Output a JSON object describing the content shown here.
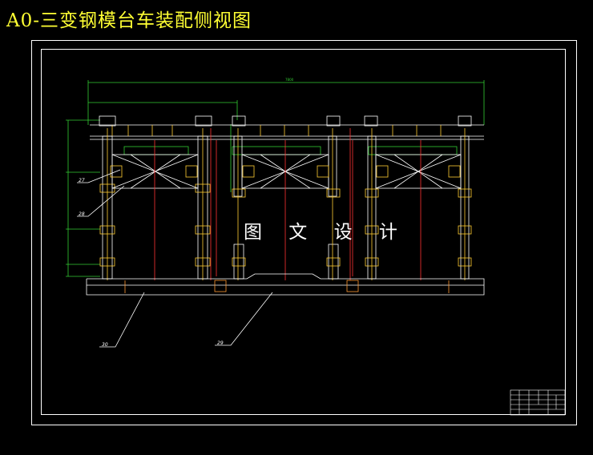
{
  "title": "A0-三变钢模台车装配侧视图",
  "watermark": "图 文 设 计",
  "callouts": [
    "27",
    "28",
    "30",
    "29"
  ],
  "colors": {
    "background": "#000000",
    "title": "#ffff33",
    "frame": "#ffffff",
    "structure_yellow": "#ffcc33",
    "structure_white": "#ffffff",
    "centerline": "#ff3333",
    "dimension": "#33cc33",
    "steel_detail": "#ff9933"
  }
}
